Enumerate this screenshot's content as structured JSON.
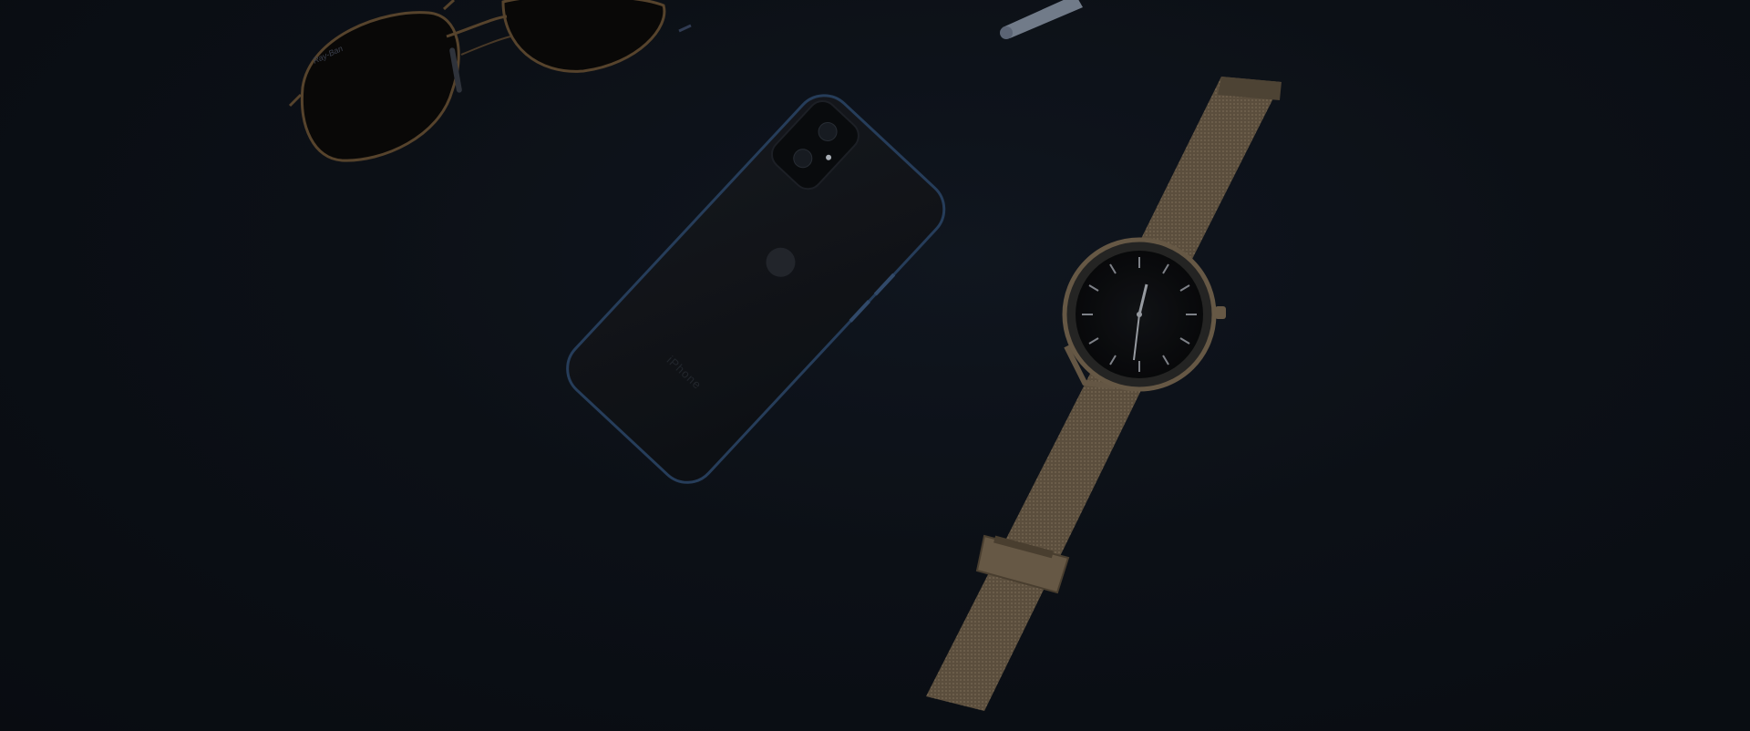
{
  "scene": {
    "objects": [
      {
        "name": "sunglasses",
        "icon": "sunglasses-icon",
        "frame_color": "#6a5236",
        "lens_color": "#0c0b0a"
      },
      {
        "name": "smartphone",
        "icon": "phone-icon",
        "body_color": "#15181d",
        "edge_color": "#2f4b6e"
      },
      {
        "name": "wristwatch",
        "icon": "watch-icon",
        "band_color": "#7d6c55",
        "dial_color": "#0f1013"
      },
      {
        "name": "pen",
        "icon": "pen-icon",
        "color": "#8a96a8"
      }
    ],
    "background_color": "#0d1118"
  },
  "labels": {
    "phone_text": "iPhone",
    "glasses_text": "Ray-Ban"
  }
}
